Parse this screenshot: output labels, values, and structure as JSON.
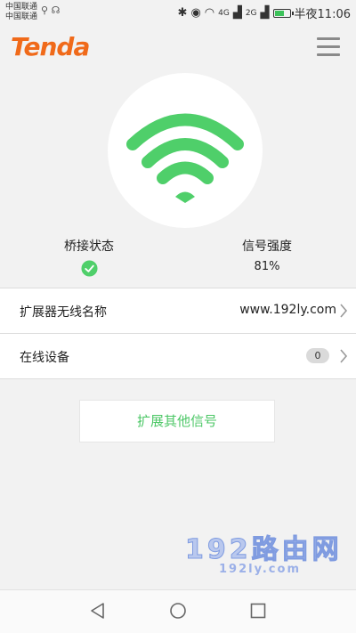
{
  "statusbar": {
    "carrier1": "中国联通",
    "carrier2": "中国联通",
    "net1": "4G",
    "net2": "2G",
    "time": "半夜11:06"
  },
  "header": {
    "logo": "Tenda"
  },
  "status": {
    "bridge_label": "桥接状态",
    "signal_label": "信号强度",
    "signal_value": "81%"
  },
  "rows": [
    {
      "label": "扩展器无线名称",
      "value": "www.192ly.com"
    },
    {
      "label": "在线设备",
      "badge": "0"
    }
  ],
  "extend_button": "扩展其他信号",
  "watermark": {
    "main": "192路由网",
    "sub": "192ly.com"
  },
  "colors": {
    "accent": "#4cc766",
    "brand": "#f06a1a"
  }
}
